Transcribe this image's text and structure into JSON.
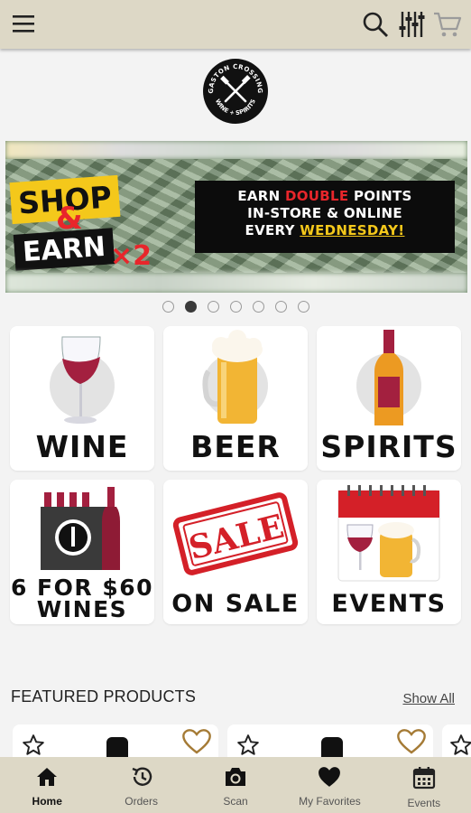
{
  "topbar": {
    "menu_icon": "hamburger-menu-icon",
    "search_icon": "search-icon",
    "filter_icon": "filter-sliders-icon",
    "cart_icon": "shopping-cart-icon"
  },
  "logo": {
    "text_top": "GASTON CROSSING",
    "text_bottom": "WINE + SPIRITS"
  },
  "banner": {
    "shop": "SHOP",
    "amp": "&",
    "earn": "EARN",
    "x2": "×2",
    "line1_a": "EARN ",
    "line1_b": "DOUBLE",
    "line1_c": " POINTS",
    "line2": "IN-STORE & ONLINE",
    "line3_a": "EVERY ",
    "line3_b": "WEDNESDAY!",
    "colors": {
      "yellow": "#f4c81b",
      "red": "#e8262b",
      "black": "#0c0c0c"
    }
  },
  "carousel": {
    "total": 7,
    "active_index": 1
  },
  "categories": [
    {
      "label": "WINE",
      "icon": "wine-glass-icon"
    },
    {
      "label": "BEER",
      "icon": "beer-mug-icon"
    },
    {
      "label": "SPIRITS",
      "icon": "liquor-bottle-icon"
    },
    {
      "label_line1": "6 FOR $60",
      "label_line2": "WINES",
      "icon": "wine-bag-icon"
    },
    {
      "label": "ON SALE",
      "stamp": "SALE",
      "icon": "sale-stamp-icon"
    },
    {
      "label": "EVENTS",
      "icon": "calendar-drinks-icon"
    }
  ],
  "featured": {
    "title": "FEATURED PRODUCTS",
    "show_all": "Show All"
  },
  "bottom_nav": [
    {
      "label": "Home",
      "icon": "home-icon",
      "active": true
    },
    {
      "label": "Orders",
      "icon": "history-icon",
      "active": false
    },
    {
      "label": "Scan",
      "icon": "camera-icon",
      "active": false
    },
    {
      "label": "My Favorites",
      "icon": "heart-icon",
      "active": false
    },
    {
      "label": "Events",
      "icon": "calendar-icon",
      "active": false
    }
  ]
}
